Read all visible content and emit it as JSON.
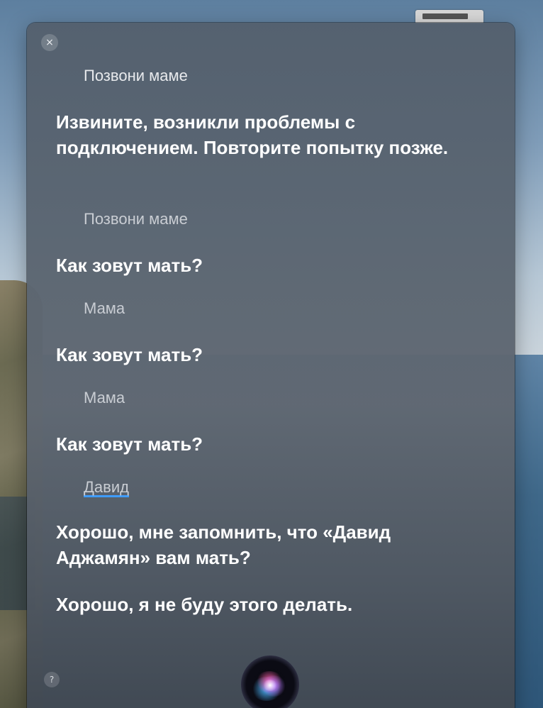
{
  "panel": {
    "close_icon": "close-icon",
    "help_label": "?",
    "close_label": "×"
  },
  "conversation": [
    {
      "role": "user",
      "text": "Позвони маме"
    },
    {
      "role": "siri",
      "text": "Извините, возникли проблемы с подключением. Повторите попытку позже."
    },
    {
      "role": "user",
      "text": "Позвони маме"
    },
    {
      "role": "siri",
      "text": "Как зовут мать?"
    },
    {
      "role": "user",
      "text": "Мама"
    },
    {
      "role": "siri",
      "text": "Как зовут мать?"
    },
    {
      "role": "user",
      "text": "Мама"
    },
    {
      "role": "siri",
      "text": "Как зовут мать?"
    },
    {
      "role": "user",
      "text": "Давид"
    },
    {
      "role": "siri",
      "text": "Хорошо, мне запомнить, что «Давид Аджамян» вам мать?"
    },
    {
      "role": "siri",
      "text": "Хорошо, я не буду этого делать."
    }
  ],
  "orb": {
    "icon": "siri-orb-icon"
  }
}
